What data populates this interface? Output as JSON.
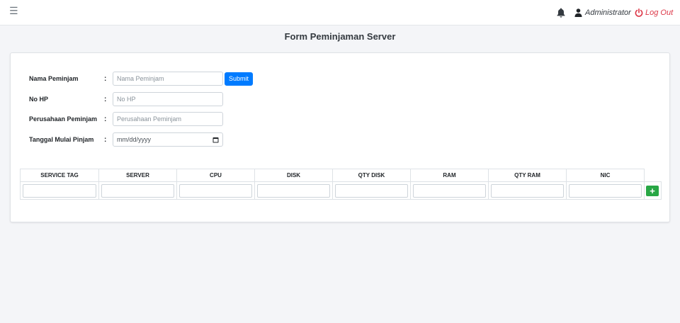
{
  "topbar": {
    "menu_icon": "hamburger-menu-icon",
    "bell_icon": "bell-icon",
    "user_icon": "user-icon",
    "user_name": "Administrator",
    "logout_icon": "power-icon",
    "logout_label": "Log Out"
  },
  "page": {
    "title": "Form Peminjaman Server"
  },
  "form": {
    "separator": ":",
    "nama": {
      "label": "Nama Peminjam",
      "placeholder": "Nama Peminjam"
    },
    "hp": {
      "label": "No HP",
      "placeholder": "No HP"
    },
    "perusahaan": {
      "label": "Perusahaan Peminjam",
      "placeholder": "Perusahaan Peminjam"
    },
    "tanggal": {
      "label": "Tanggal Mulai Pinjam",
      "placeholder": "mm/dd/yyyy"
    },
    "submit_label": "Submit"
  },
  "table": {
    "headers": [
      "SERVICE TAG",
      "SERVER",
      "CPU",
      "DISK",
      "QTY DISK",
      "RAM",
      "QTY RAM",
      "NIC"
    ],
    "add_label": "+"
  },
  "colors": {
    "primary": "#007bff",
    "success": "#28a745",
    "danger": "#dc3545",
    "background": "#f4f5f8"
  }
}
